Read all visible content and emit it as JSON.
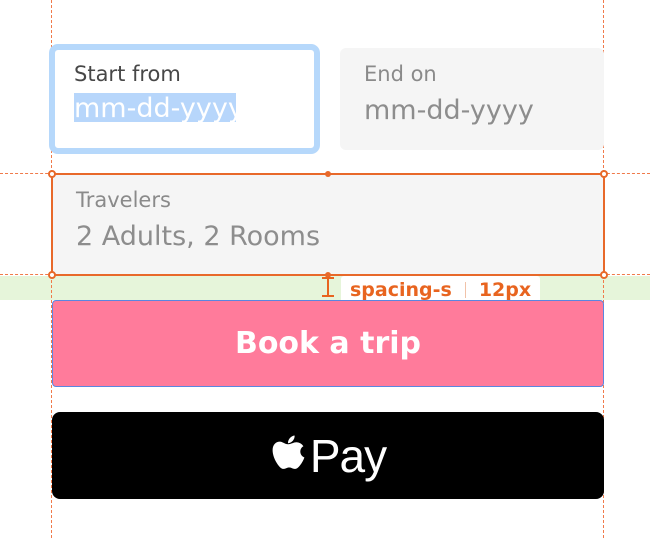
{
  "form": {
    "start": {
      "label": "Start from",
      "placeholder": "mm-dd-yyyy"
    },
    "end": {
      "label": "End on",
      "placeholder": "mm-dd-yyyy"
    },
    "travelers": {
      "label": "Travelers",
      "value": "2 Adults, 2 Rooms"
    },
    "book_label": "Book a trip",
    "apple_pay_text": "Pay"
  },
  "spacing_annotation": {
    "token": "spacing-s",
    "value": "12px"
  },
  "colors": {
    "guide": "#f07a4a",
    "selection": "#e8692a",
    "focus_ring": "#b6d8fb",
    "book_button": "#ff7b9b",
    "apple_pay_button": "#000000",
    "spacing_band": "#e6f5da"
  },
  "icons": {
    "apple_logo": "apple-logo-icon",
    "spacing": "spacing-i-beam-icon"
  }
}
